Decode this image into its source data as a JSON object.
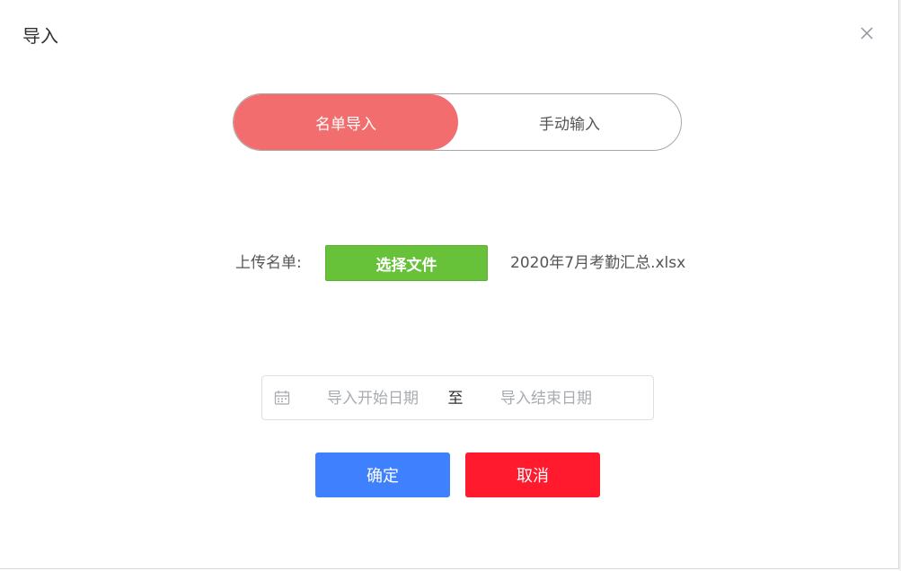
{
  "dialog": {
    "title": "导入"
  },
  "mode_toggle": {
    "options": [
      {
        "label": "名单导入",
        "active": true
      },
      {
        "label": "手动输入",
        "active": false
      }
    ]
  },
  "upload": {
    "label": "上传名单:",
    "button_label": "选择文件",
    "file_name": "2020年7月考勤汇总.xlsx"
  },
  "date_range": {
    "start_placeholder": "导入开始日期",
    "separator": "至",
    "end_placeholder": "导入结束日期"
  },
  "actions": {
    "confirm_label": "确定",
    "cancel_label": "取消"
  },
  "colors": {
    "toggle_active": "#f26d6d",
    "choose_file": "#67c23a",
    "confirm": "#3f80ff",
    "cancel": "#ff1a2e"
  },
  "icons": {
    "close": "close-icon",
    "calendar": "calendar-icon"
  }
}
